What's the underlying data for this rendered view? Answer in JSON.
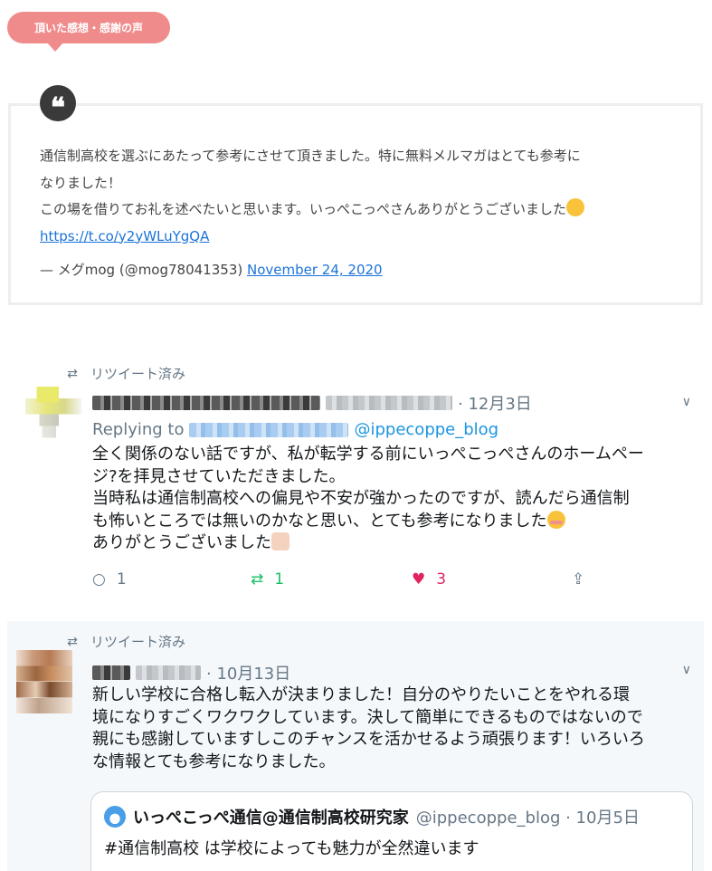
{
  "section_tag": "頂いた感想・感謝の声",
  "quote": {
    "icon": "quote-icon",
    "line1": "通信制高校を選ぶにあたって参考にさせて頂きました。特に無料メルマガはとても参考に",
    "line2": "なりました！",
    "line3": "この場を借りてお礼を述べたいと思います。いっぺこっぺさんありがとうございました",
    "link": "https://t.co/y2yWLuYgQA",
    "cite_prefix": "— メグmog (@mog78041353)",
    "cite_date": "November 24, 2020"
  },
  "tweet1": {
    "retweet_label": "リツイート済み",
    "date": "· 12月3日",
    "replying_to": "Replying to",
    "mention": "@ippecoppe_blog",
    "body_line1": "全く関係のない話ですが、私が転学する前にいっぺこっぺさんのホームペー",
    "body_line2": "ジ?を拝見させていただきました。",
    "body_line3": "当時私は通信制高校への偏見や不安が強かったのですが、読んだら通信制",
    "body_line4": "も怖いところでは無いのかなと思い、とても参考になりました",
    "body_line5": "ありがとうございました",
    "replies": "1",
    "retweets": "1",
    "likes": "3"
  },
  "tweet2": {
    "retweet_label": "リツイート済み",
    "date": "· 10月13日",
    "body_line1": "新しい学校に合格し転入が決まりました！自分のやりたいことをやれる環",
    "body_line2": "境になりすごくワクワクしています。決して簡単にできるものではないので",
    "body_line3": "親にも感謝していますしこのチャンスを活かせるよう頑張ります！いろいろ",
    "body_line4": "な情報とても参考になりました。",
    "quoted": {
      "name": "いっぺこっぺ通信@通信制高校研究家",
      "handle": "@ippecoppe_blog · 10月5日",
      "text": "#通信制高校 は学校によっても魅力が全然違います"
    }
  },
  "colors": {
    "tag_bg": "#f08b8b",
    "link": "#1a73d9",
    "mention": "#1b95e0",
    "retweet_green": "#17bf63",
    "like_red": "#e0245e"
  }
}
